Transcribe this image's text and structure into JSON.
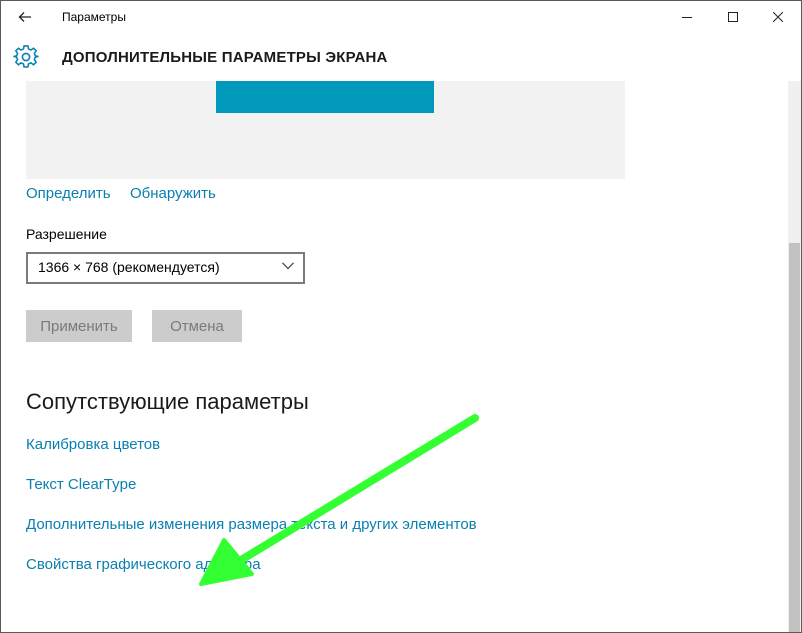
{
  "window": {
    "app_title": "Параметры",
    "page_title": "ДОПОЛНИТЕЛЬНЫЕ ПАРАМЕТРЫ ЭКРАНА"
  },
  "icons": {
    "back": "back-arrow-icon",
    "settings": "gear-icon",
    "minimize": "minimize-icon",
    "maximize": "maximize-icon",
    "close": "close-icon",
    "dropdown": "chevron-down-icon"
  },
  "display": {
    "identify_link": "Определить",
    "detect_link": "Обнаружить",
    "resolution_label": "Разрешение",
    "resolution_value": "1366 × 768 (рекомендуется)",
    "apply_button": "Применить",
    "cancel_button": "Отмена"
  },
  "related": {
    "title": "Сопутствующие параметры",
    "links": [
      "Калибровка цветов",
      "Текст ClearType",
      "Дополнительные изменения размера текста и других элементов",
      "Свойства графического адаптера"
    ]
  },
  "colors": {
    "accent": "#0099bc",
    "link": "#0a7fb0",
    "annotation_arrow": "#33ff33"
  }
}
